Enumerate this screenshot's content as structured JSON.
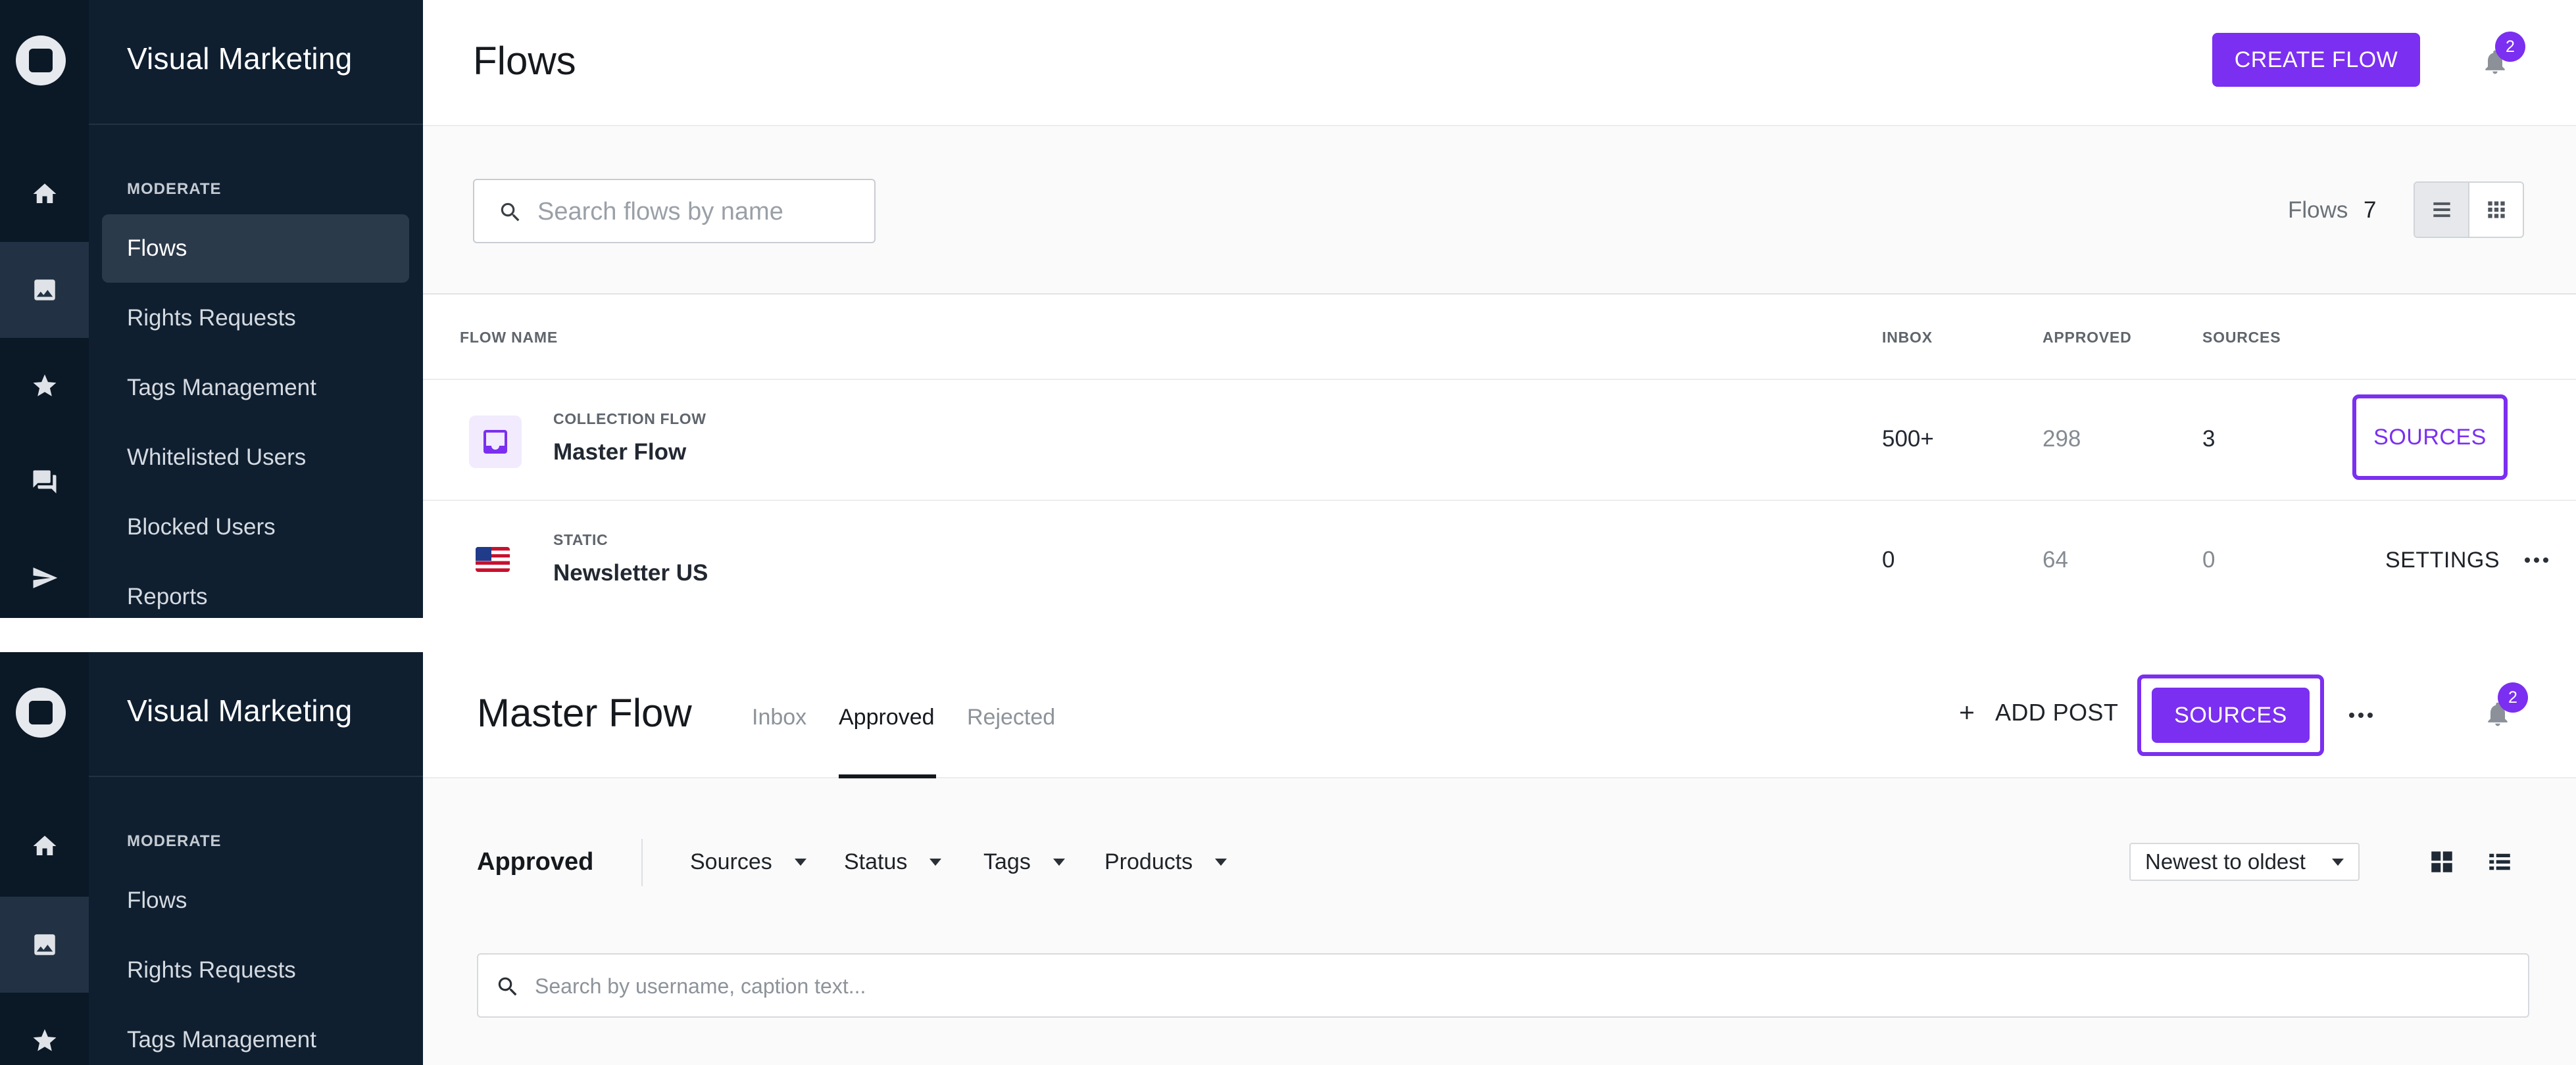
{
  "brand": "Visual Marketing",
  "colors": {
    "accent": "#7b2ff0",
    "sidebar": "#0f1f30",
    "rail": "#0b1826"
  },
  "rail_icons": [
    "home-icon",
    "image-icon",
    "star-icon",
    "chat-icon",
    "send-icon"
  ],
  "top": {
    "nav": {
      "section": "MODERATE",
      "items": [
        "Flows",
        "Rights Requests",
        "Tags Management",
        "Whitelisted Users",
        "Blocked Users",
        "Reports"
      ],
      "active": "Flows"
    },
    "header": {
      "title": "Flows",
      "create_button": "CREATE FLOW",
      "notification_count": "2"
    },
    "filters": {
      "search_placeholder": "Search flows by name",
      "count_label": "Flows",
      "count_value": "7"
    },
    "table": {
      "columns": [
        "FLOW NAME",
        "INBOX",
        "APPROVED",
        "SOURCES"
      ],
      "rows": [
        {
          "type": "COLLECTION FLOW",
          "name": "Master Flow",
          "inbox": "500+",
          "approved": "298",
          "sources": "3",
          "action": "SOURCES",
          "icon": "inbox-icon"
        },
        {
          "type": "STATIC",
          "name": "Newsletter US",
          "inbox": "0",
          "approved": "64",
          "sources": "0",
          "action": "SETTINGS",
          "icon": "us-flag-icon"
        }
      ]
    }
  },
  "bottom": {
    "nav": {
      "section": "MODERATE",
      "items": [
        "Flows",
        "Rights Requests",
        "Tags Management"
      ]
    },
    "header": {
      "title": "Master Flow",
      "tabs": [
        "Inbox",
        "Approved",
        "Rejected"
      ],
      "active_tab": "Approved",
      "add_post": "ADD POST",
      "sources_button": "SOURCES",
      "notification_count": "2"
    },
    "filters": {
      "title": "Approved",
      "dropdowns": [
        "Sources",
        "Status",
        "Tags",
        "Products"
      ],
      "sort": "Newest to oldest",
      "search_placeholder": "Search by username, caption text..."
    }
  }
}
